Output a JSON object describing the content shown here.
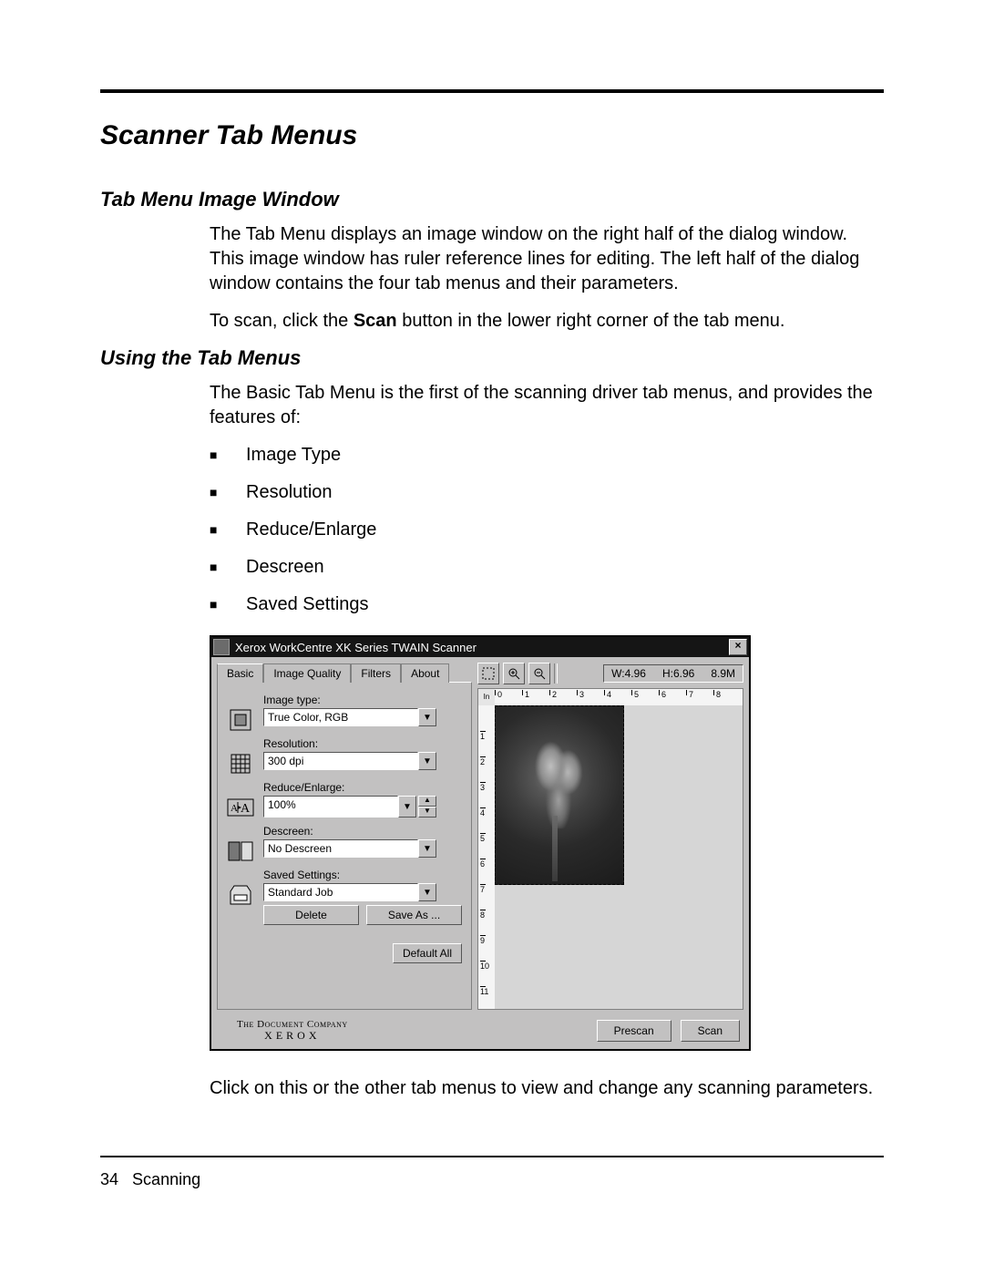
{
  "doc": {
    "h1": "Scanner Tab Menus",
    "h2a": "Tab Menu Image Window",
    "p1": "The Tab Menu displays an image window on the right half of the dialog window. This image window has ruler reference lines for editing. The left half of the dialog window contains the four tab menus and their parameters.",
    "p2_pre": "To scan, click the ",
    "p2_bold": "Scan",
    "p2_post": " button in the lower right corner of the tab menu.",
    "h2b": "Using the Tab Menus",
    "p3": "The Basic Tab Menu is the first of the scanning driver tab menus, and provides the features of:",
    "bullets": [
      "Image Type",
      "Resolution",
      "Reduce/Enlarge",
      "Descreen",
      "Saved Settings"
    ],
    "p4": "Click on this or the other tab menus to view and change any scanning parameters.",
    "footer_num": "34",
    "footer_label": "Scanning"
  },
  "dialog": {
    "title": "Xerox WorkCentre XK Series TWAIN Scanner",
    "close": "×",
    "tabs": [
      "Basic",
      "Image Quality",
      "Filters",
      "About"
    ],
    "fields": {
      "image_type_label": "Image type:",
      "image_type_value": "True Color, RGB",
      "resolution_label": "Resolution:",
      "resolution_value": "300 dpi",
      "reduce_label": "Reduce/Enlarge:",
      "reduce_value": "100%",
      "descreen_label": "Descreen:",
      "descreen_value": "No Descreen",
      "saved_label": "Saved Settings:",
      "saved_value": "Standard Job",
      "delete_btn": "Delete",
      "saveas_btn": "Save As ...",
      "default_btn": "Default All"
    },
    "toolbar": {
      "status_w": "W:4.96",
      "status_h": "H:6.96",
      "status_size": "8.9M"
    },
    "ruler": {
      "unit": "In",
      "h_ticks": [
        "0",
        "1",
        "2",
        "3",
        "4",
        "5",
        "6",
        "7",
        "8"
      ],
      "v_ticks": [
        "1",
        "2",
        "3",
        "4",
        "5",
        "6",
        "7",
        "8",
        "9",
        "10",
        "11"
      ]
    },
    "brand_line1": "The Document Company",
    "brand_line2": "XEROX",
    "prescan_btn": "Prescan",
    "scan_btn": "Scan"
  }
}
